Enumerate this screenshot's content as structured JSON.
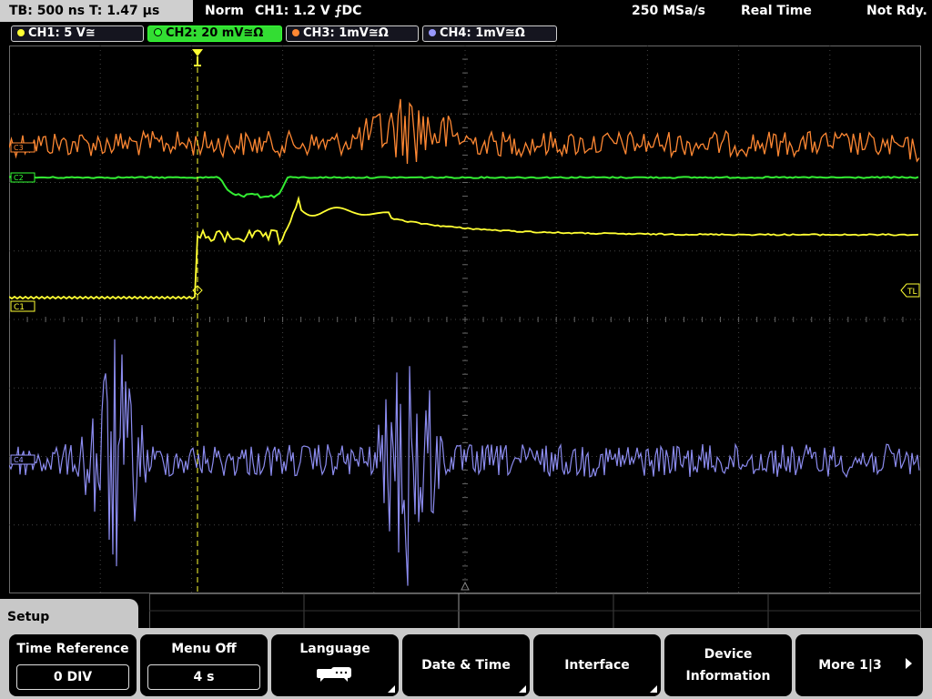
{
  "status": {
    "timebase": "TB: 500 ns   T: 1.47 µs",
    "mode": "Norm",
    "trigger": "CH1: 1.2 V ⨍DC",
    "sample_rate": "250 MSa/s",
    "acq_mode": "Real Time",
    "ready_state": "Not Rdy."
  },
  "channels": [
    {
      "label": "CH1: 5 V≅",
      "color": "#ffff33"
    },
    {
      "label": "CH2: 20 mV≅Ω",
      "color": "#33ff33"
    },
    {
      "label": "CH3: 1mV≅Ω",
      "color": "#ff8833"
    },
    {
      "label": "CH4: 1mV≅Ω",
      "color": "#9999ff"
    }
  ],
  "markers": {
    "ch1_ground": "C1",
    "trigger_level": "TL",
    "ch2_ground": "C2",
    "ch3_ground": "C3",
    "ch4_ground": "C4"
  },
  "menu": {
    "tab_label": "Setup",
    "softkeys": [
      {
        "label": "Time Reference",
        "value": "0 DIV"
      },
      {
        "label": "Menu Off",
        "value": "4 s"
      },
      {
        "label": "Language"
      },
      {
        "label": "Date & Time"
      },
      {
        "label": "Interface"
      },
      {
        "label_line1": "Device",
        "label_line2": "Information"
      },
      {
        "label": "More 1|3"
      }
    ]
  },
  "colors": {
    "grid": "#5a5a5a",
    "trigger_line": "#ffff33"
  }
}
